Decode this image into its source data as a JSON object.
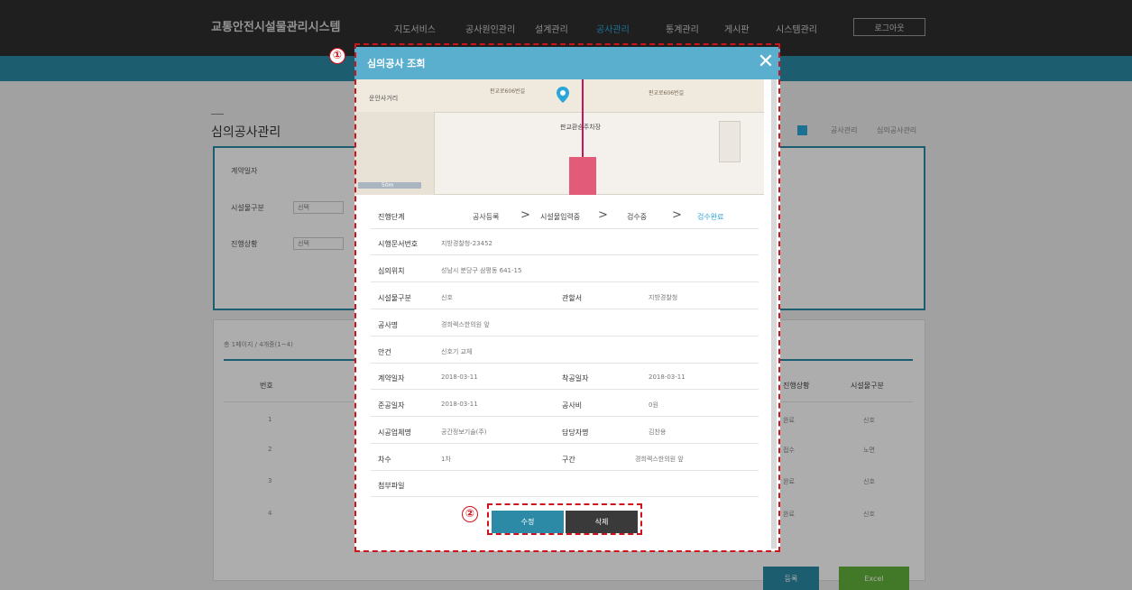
{
  "header": {
    "brand": "교통안전시설물관리시스템",
    "nav": [
      "지도서비스",
      "공사원인관리",
      "설계관리",
      "공사관리",
      "통계관리",
      "게시판",
      "시스템관리"
    ],
    "active_nav": "공사관리",
    "logout": "로그아웃"
  },
  "page": {
    "title": "심의공사관리",
    "breadcrumb": [
      "공사관리",
      "심의공사관리"
    ],
    "search": {
      "contract_date_label": "계약일자",
      "facility_type_label": "시설물구분",
      "facility_type_value": "선택",
      "progress_label": "진행상황",
      "progress_value": "선택"
    },
    "list": {
      "info": "총 1페이지 / 4개중(1~4)",
      "columns": [
        "번호",
        "진행상황",
        "시설물구분"
      ],
      "rows": [
        {
          "no": "1",
          "status": "완료",
          "type": "신호"
        },
        {
          "no": "2",
          "status": "접수",
          "type": "노면"
        },
        {
          "no": "3",
          "status": "완료",
          "type": "신호"
        },
        {
          "no": "4",
          "status": "완료",
          "type": "신호"
        }
      ],
      "register_button": "등록",
      "excel_button": "Excel"
    }
  },
  "modal": {
    "title": "심의공사 조회",
    "close_icon": "close-icon",
    "map": {
      "labels": [
        "판교로606번길",
        "판교로606번길",
        "판교환승주차장",
        "운안사거리"
      ],
      "scale": "50m"
    },
    "progress": {
      "label": "진행단계",
      "steps": [
        "공사등록",
        "시설물입력중",
        "검수중",
        "검수완료"
      ],
      "current": "검수완료"
    },
    "fields": {
      "doc_no": {
        "label": "시행문서번호",
        "value": "지방경찰청-23452"
      },
      "location": {
        "label": "심의위치",
        "value": "성남시 분당구 삼평동 641-15"
      },
      "facility_type": {
        "label": "시설물구분",
        "value": "신호"
      },
      "office": {
        "label": "관할서",
        "value": "지방경찰청"
      },
      "work_name": {
        "label": "공사명",
        "value": "경희렉스한의원 앞"
      },
      "agenda": {
        "label": "안건",
        "value": "신호기 교체"
      },
      "contract_date": {
        "label": "계약일자",
        "value": "2018-03-11"
      },
      "start_date": {
        "label": "착공일자",
        "value": "2018-03-11"
      },
      "complete_date": {
        "label": "준공일자",
        "value": "2018-03-11"
      },
      "cost": {
        "label": "공사비",
        "value": "0원"
      },
      "contractor": {
        "label": "시공업체명",
        "value": "공간정보기술(주)"
      },
      "manager": {
        "label": "담당자명",
        "value": "김찬용"
      },
      "round": {
        "label": "차수",
        "value": "1차"
      },
      "section": {
        "label": "구간",
        "value": "경희렉스한의원 앞"
      },
      "attachment": {
        "label": "첨부파일",
        "value": ""
      }
    },
    "edit_button": "수정",
    "delete_button": "삭제"
  },
  "annotations": {
    "one": "①",
    "two": "②"
  },
  "colors": {
    "accent": "#2c8aa6",
    "modal_header": "#5aafcf",
    "annotation": "#d0121b",
    "excel": "#62b33b"
  }
}
